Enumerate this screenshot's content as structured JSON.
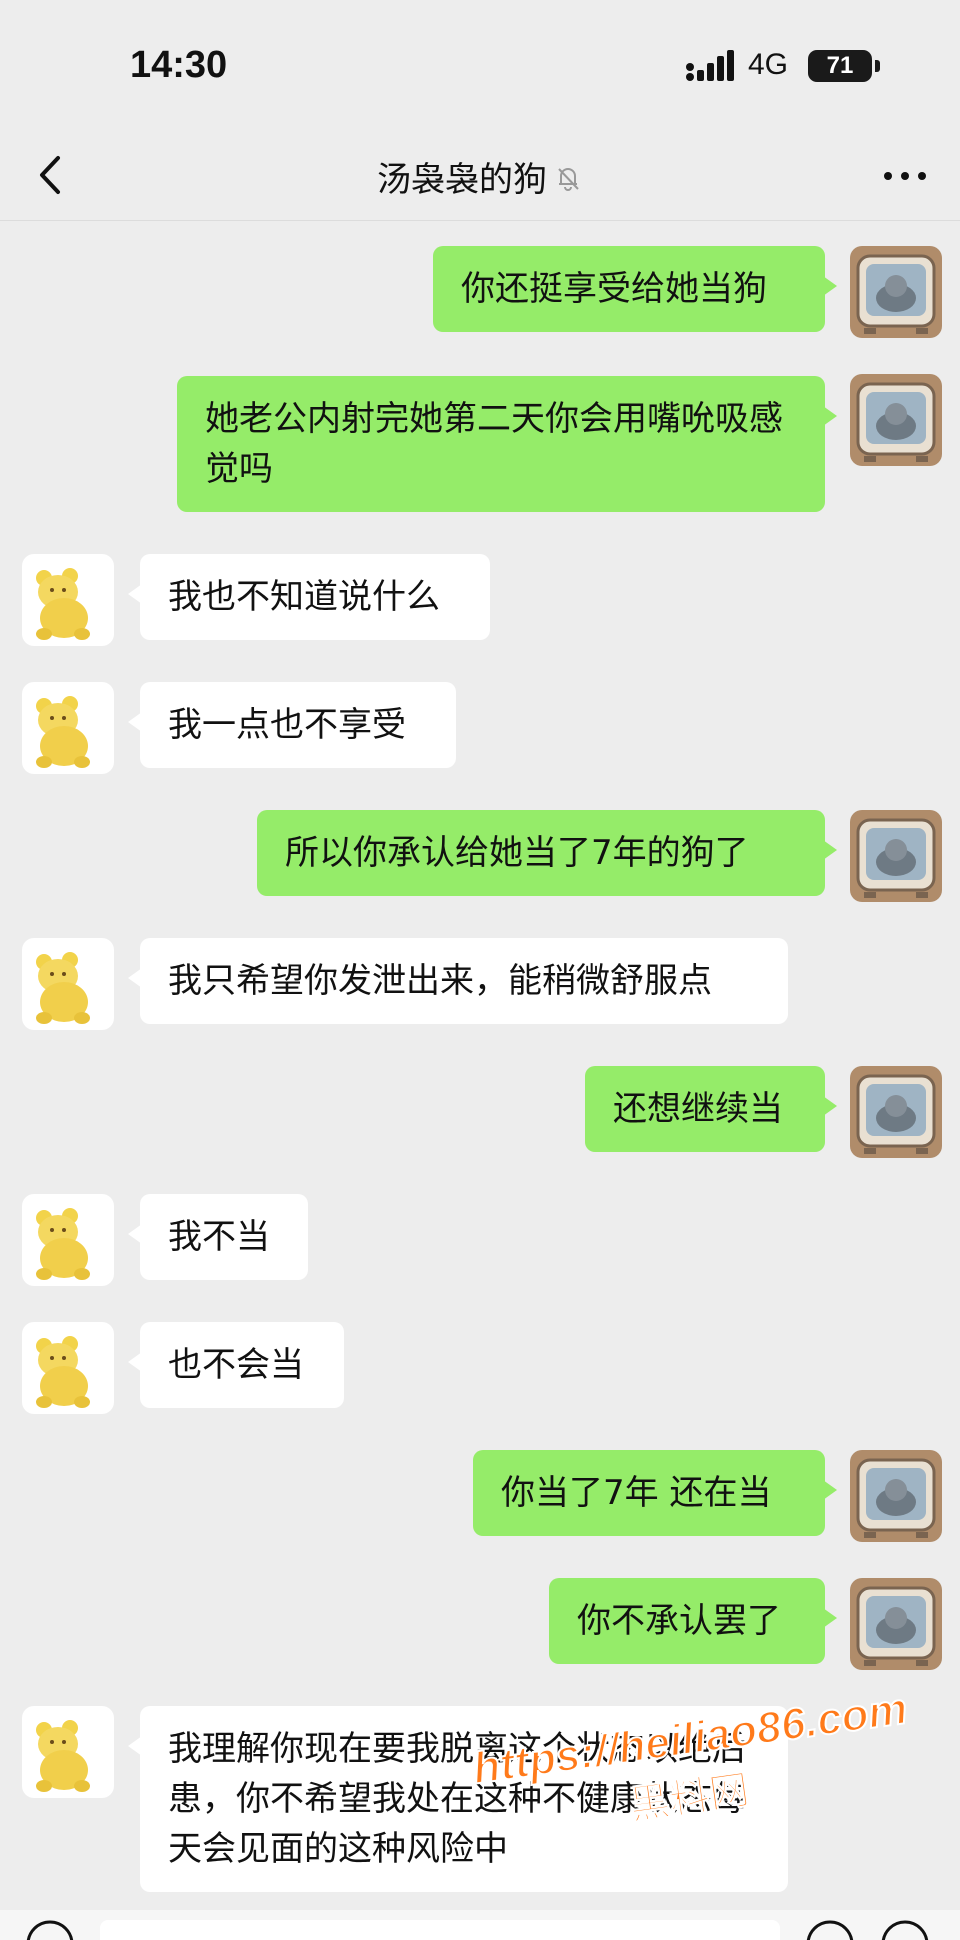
{
  "status": {
    "time": "14:30",
    "network": "4G",
    "battery": "71"
  },
  "header": {
    "title": "汤袅袅的狗"
  },
  "messages": [
    {
      "from": "me",
      "text": "你还挺享受给她当狗"
    },
    {
      "from": "me",
      "text": "她老公内射完她第二天你会用嘴吮吸感觉吗"
    },
    {
      "from": "them",
      "text": "我也不知道说什么"
    },
    {
      "from": "them",
      "text": "我一点也不享受"
    },
    {
      "from": "me",
      "text": "所以你承认给她当了7年的狗了"
    },
    {
      "from": "them",
      "text": "我只希望你发泄出来，能稍微舒服点"
    },
    {
      "from": "me",
      "text": "还想继续当"
    },
    {
      "from": "them",
      "text": "我不当"
    },
    {
      "from": "them",
      "text": "也不会当"
    },
    {
      "from": "me",
      "text": "你当了7年 还在当"
    },
    {
      "from": "me",
      "text": "你不承认罢了"
    },
    {
      "from": "them",
      "text": "我理解你现在要我脱离这个状态以绝后患，你不希望我处在这种不健康状态每天会见面的这种风险中"
    }
  ],
  "watermark": {
    "url": "https://heiliao86.com",
    "cn": "黑料网"
  },
  "colors": {
    "me_bubble": "#95ec69",
    "them_bubble": "#ffffff",
    "background": "#ededed"
  },
  "icons": {
    "back": "chevron-left-icon",
    "mute": "bell-off-icon",
    "more": "more-dots-icon",
    "signal": "signal-icon"
  }
}
